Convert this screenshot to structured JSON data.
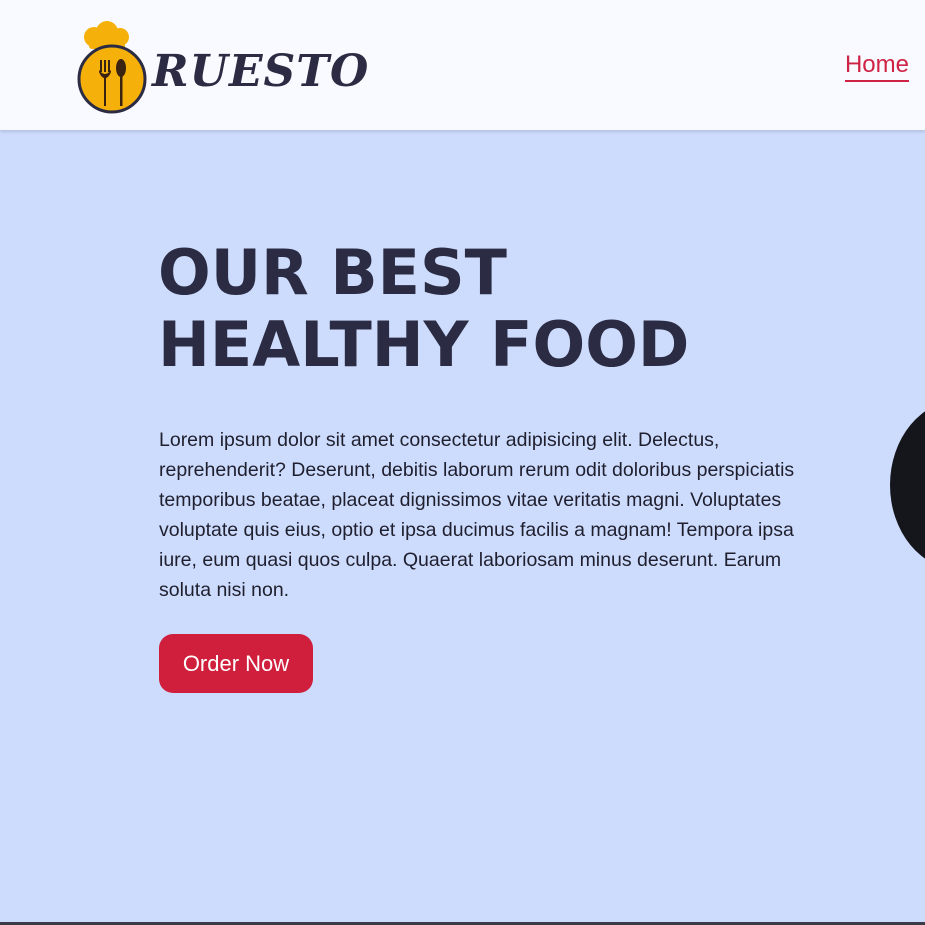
{
  "header": {
    "brand": "RUESTO",
    "nav": {
      "home_label": "Home"
    }
  },
  "hero": {
    "title": "OUR BEST\nHEALTHY FOOD",
    "description": "Lorem ipsum dolor sit amet consectetur adipisicing elit. Delectus, reprehenderit? Deserunt, debitis laborum rerum odit doloribus perspiciatis temporibus beatae, placeat dignissimos vitae veritatis magni. Voluptates voluptate quis eius, optio et ipsa ducimus facilis a magnam! Tempora ipsa iure, eum quasi quos culpa. Quaerat laboriosam minus deserunt. Earum soluta nisi non.",
    "cta_label": "Order Now"
  },
  "colors": {
    "header_bg": "#f8faff",
    "hero_bg": "#cddcfd",
    "heading": "#2b2c43",
    "accent": "#d01f3c",
    "logo_gold": "#f5b10a"
  },
  "icons": {
    "logo": "chef-hat-fork-spoon-icon"
  }
}
